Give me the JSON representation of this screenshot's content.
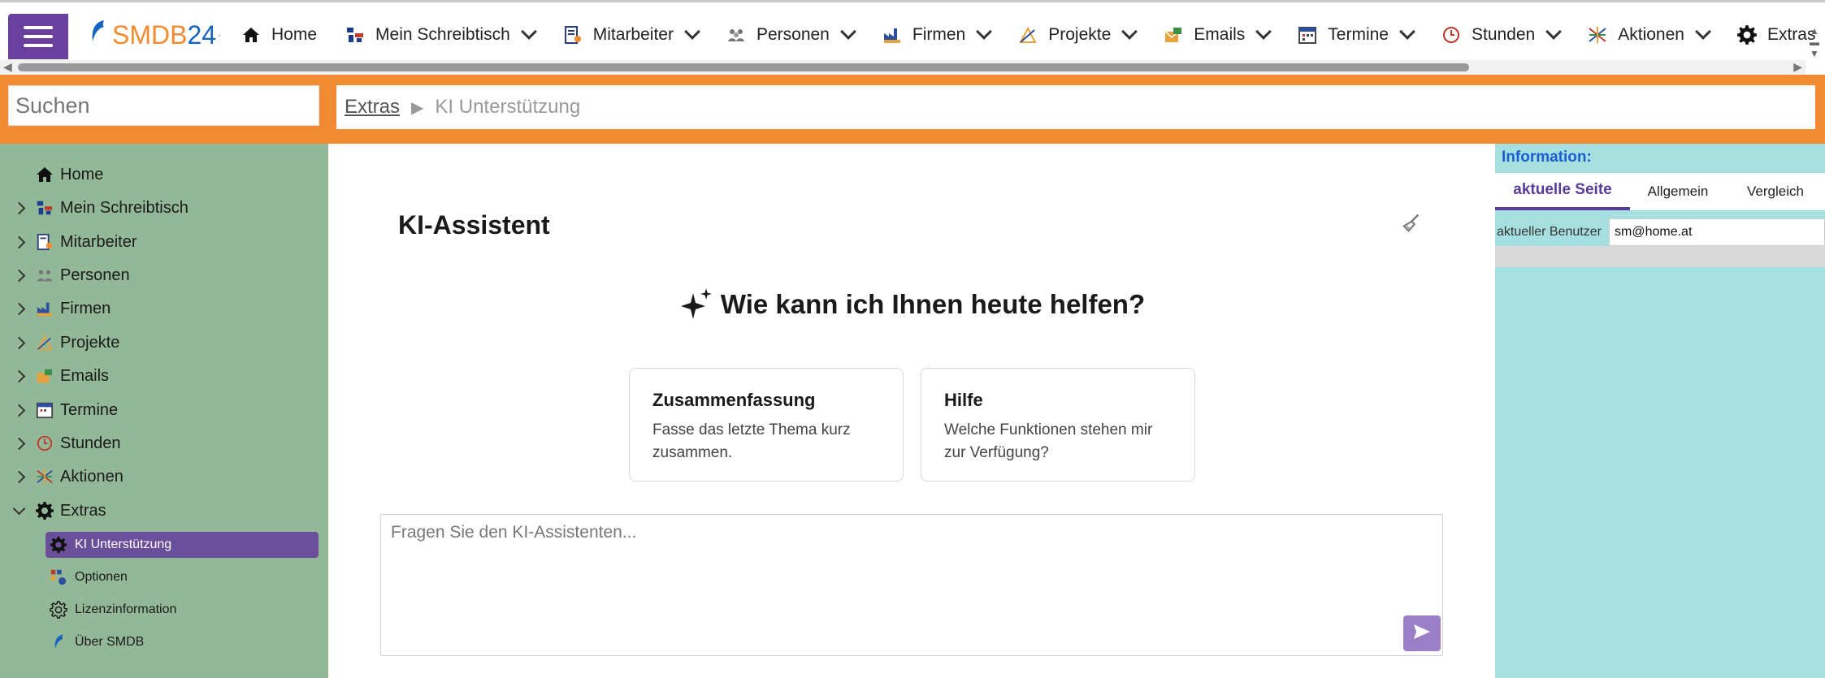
{
  "app": {
    "logo_brand": "SMDB",
    "logo_number": "24",
    "logo_dot": "·"
  },
  "nav": {
    "items": [
      {
        "label": "Home",
        "icon": "home-icon",
        "has_menu": false
      },
      {
        "label": "Mein Schreibtisch",
        "icon": "desk-icon",
        "has_menu": true
      },
      {
        "label": "Mitarbeiter",
        "icon": "employee-icon",
        "has_menu": true
      },
      {
        "label": "Personen",
        "icon": "people-icon",
        "has_menu": true
      },
      {
        "label": "Firmen",
        "icon": "factory-icon",
        "has_menu": true
      },
      {
        "label": "Projekte",
        "icon": "project-icon",
        "has_menu": true
      },
      {
        "label": "Emails",
        "icon": "email-icon",
        "has_menu": true
      },
      {
        "label": "Termine",
        "icon": "calendar-icon",
        "has_menu": true
      },
      {
        "label": "Stunden",
        "icon": "clock-icon",
        "has_menu": true
      },
      {
        "label": "Aktionen",
        "icon": "actions-icon",
        "has_menu": true
      },
      {
        "label": "Extras",
        "icon": "gear-icon",
        "has_menu": true
      }
    ]
  },
  "search": {
    "placeholder": "Suchen"
  },
  "breadcrumb": {
    "parent": "Extras",
    "separator": "▶",
    "current": "KI Unterstützung"
  },
  "sidebar": {
    "items": [
      {
        "label": "Home",
        "icon": "home-icon",
        "expandable": false
      },
      {
        "label": "Mein Schreibtisch",
        "icon": "desk-icon",
        "expandable": true
      },
      {
        "label": "Mitarbeiter",
        "icon": "employee-icon",
        "expandable": true
      },
      {
        "label": "Personen",
        "icon": "people-icon",
        "expandable": true
      },
      {
        "label": "Firmen",
        "icon": "factory-icon",
        "expandable": true
      },
      {
        "label": "Projekte",
        "icon": "project-icon",
        "expandable": true
      },
      {
        "label": "Emails",
        "icon": "email-icon",
        "expandable": true
      },
      {
        "label": "Termine",
        "icon": "calendar-icon",
        "expandable": true
      },
      {
        "label": "Stunden",
        "icon": "clock-icon",
        "expandable": true
      },
      {
        "label": "Aktionen",
        "icon": "actions-icon",
        "expandable": true
      },
      {
        "label": "Extras",
        "icon": "gear-icon",
        "expandable": true,
        "expanded": true
      }
    ],
    "subitems": [
      {
        "label": "KI Unterstützung",
        "icon": "gear-icon",
        "active": true
      },
      {
        "label": "Optionen",
        "icon": "options-icon",
        "active": false
      },
      {
        "label": "Lizenzinformation",
        "icon": "gear-outline-icon",
        "active": false
      },
      {
        "label": "Über SMDB",
        "icon": "dolphin-icon",
        "active": false
      }
    ]
  },
  "main": {
    "title": "KI-Assistent",
    "greeting": "Wie kann ich Ihnen heute helfen?",
    "cards": [
      {
        "title": "Zusammenfassung",
        "desc": "Fasse das letzte Thema kurz zusammen."
      },
      {
        "title": "Hilfe",
        "desc": "Welche Funktionen stehen mir zur Verfügung?"
      }
    ],
    "chat_placeholder": "Fragen Sie den KI-Assistenten..."
  },
  "info": {
    "title": "Information:",
    "tabs": [
      {
        "label": "aktuelle Seite",
        "active": true
      },
      {
        "label": "Allgemein",
        "active": false
      },
      {
        "label": "Vergleich",
        "active": false
      }
    ],
    "row_label": "aktueller Benutzer",
    "row_value": "sm@home.at"
  },
  "colors": {
    "accent_purple": "#6a3fa0",
    "orange": "#f28a33",
    "sidebar_green": "#93b898",
    "info_cyan": "#a6dfdf",
    "link_blue": "#1a5fd0"
  }
}
